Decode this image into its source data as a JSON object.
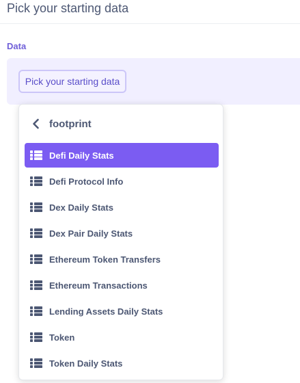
{
  "page": {
    "title": "Pick your starting data"
  },
  "data_section": {
    "label": "Data",
    "pick_button_label": "Pick your starting data"
  },
  "popover": {
    "header_label": "footprint",
    "back_icon": "chevron-left-icon",
    "item_icon": "list-icon",
    "selected_index": 0,
    "colors": {
      "accent": "#7b5cf2",
      "text": "#4c5773"
    },
    "items": [
      {
        "label": "Defi Daily Stats"
      },
      {
        "label": "Defi Protocol Info"
      },
      {
        "label": "Dex Daily Stats"
      },
      {
        "label": "Dex Pair Daily Stats"
      },
      {
        "label": "Ethereum Token Transfers"
      },
      {
        "label": "Ethereum Transactions"
      },
      {
        "label": "Lending Assets Daily Stats"
      },
      {
        "label": "Token"
      },
      {
        "label": "Token Daily Stats"
      }
    ]
  }
}
